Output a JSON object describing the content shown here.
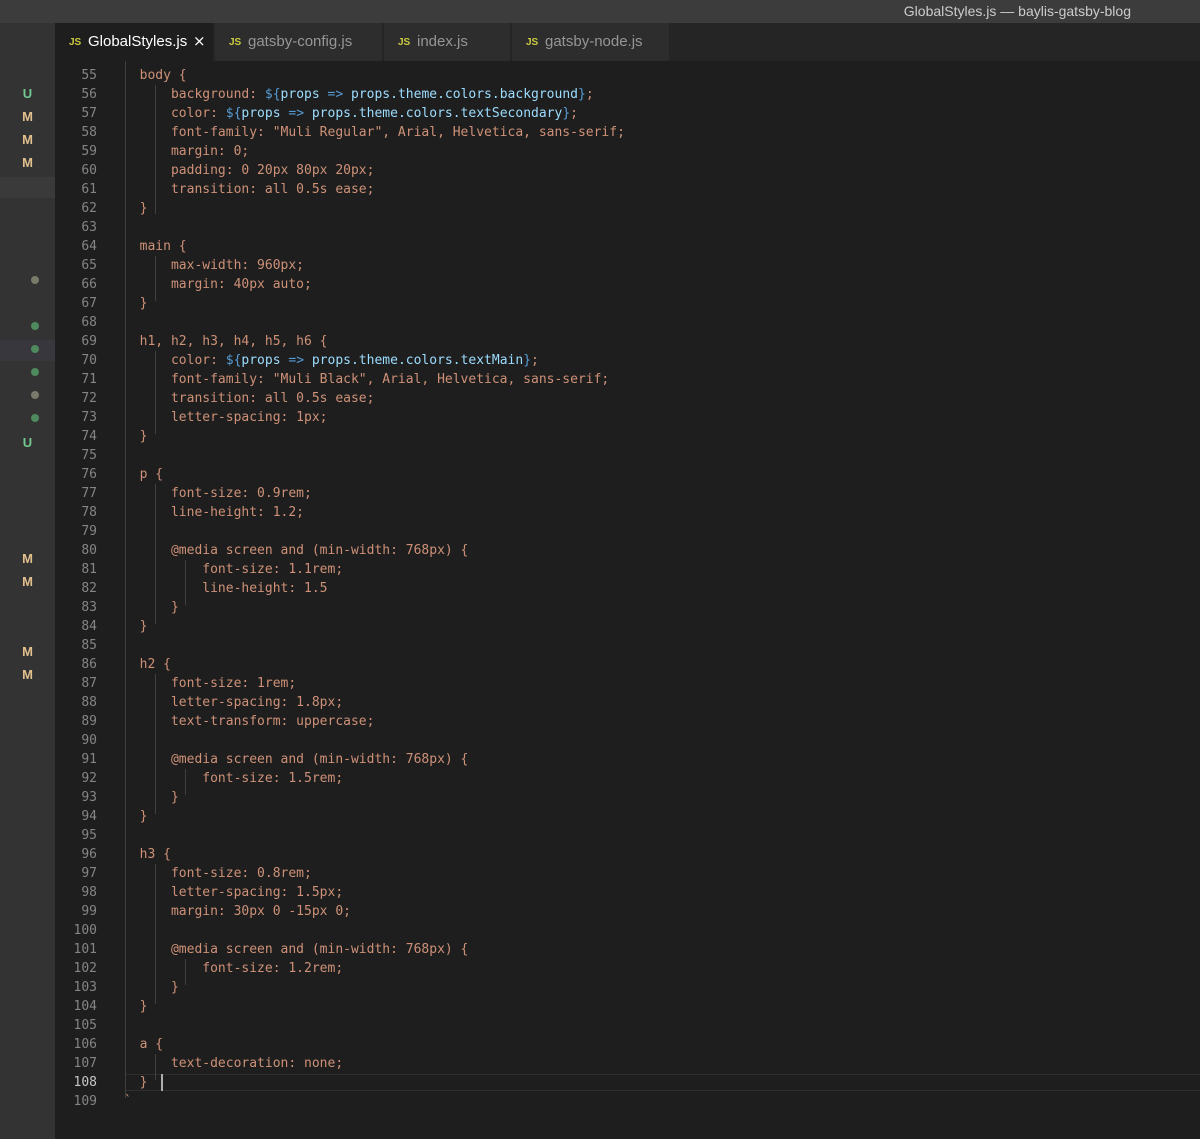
{
  "window": {
    "title": "GlobalStyles.js — baylis-gatsby-blog"
  },
  "tabs": [
    {
      "icon": "JS",
      "label": "GlobalStyles.js",
      "active": true
    },
    {
      "icon": "JS",
      "label": "gatsby-config.js",
      "active": false
    },
    {
      "icon": "JS",
      "label": "index.js",
      "active": false
    },
    {
      "icon": "JS",
      "label": "gatsby-node.js",
      "active": false
    }
  ],
  "close_glyph": "×",
  "current_line": 108,
  "colors": {
    "background": "#1e1e1e",
    "tab_icon": "#cbcb41",
    "text": "#ce9178",
    "keyword": "#569cd6",
    "variable": "#9cdcfe",
    "git_untracked": "#73c991",
    "git_modified": "#e2c08d"
  },
  "scm_markers": [
    {
      "text": "U",
      "type": "untracked"
    },
    {
      "text": "M",
      "type": "modified"
    },
    {
      "text": "M",
      "type": "modified"
    },
    {
      "text": "M",
      "type": "modified"
    },
    {
      "text": "U",
      "type": "untracked"
    },
    {
      "text": "M",
      "type": "modified"
    },
    {
      "text": "M",
      "type": "modified"
    },
    {
      "text": "M",
      "type": "modified"
    },
    {
      "text": "M",
      "type": "modified"
    }
  ],
  "code_lines": [
    {
      "n": "55",
      "text": "  body {"
    },
    {
      "n": "56",
      "text": "      background: ${props => props.theme.colors.background};"
    },
    {
      "n": "57",
      "text": "      color: ${props => props.theme.colors.textSecondary};"
    },
    {
      "n": "58",
      "text": "      font-family: \"Muli Regular\", Arial, Helvetica, sans-serif;"
    },
    {
      "n": "59",
      "text": "      margin: 0;"
    },
    {
      "n": "60",
      "text": "      padding: 0 20px 80px 20px;"
    },
    {
      "n": "61",
      "text": "      transition: all 0.5s ease;"
    },
    {
      "n": "62",
      "text": "  }"
    },
    {
      "n": "63",
      "text": ""
    },
    {
      "n": "64",
      "text": "  main {"
    },
    {
      "n": "65",
      "text": "      max-width: 960px;"
    },
    {
      "n": "66",
      "text": "      margin: 40px auto;"
    },
    {
      "n": "67",
      "text": "  }"
    },
    {
      "n": "68",
      "text": ""
    },
    {
      "n": "69",
      "text": "  h1, h2, h3, h4, h5, h6 {"
    },
    {
      "n": "70",
      "text": "      color: ${props => props.theme.colors.textMain};"
    },
    {
      "n": "71",
      "text": "      font-family: \"Muli Black\", Arial, Helvetica, sans-serif;"
    },
    {
      "n": "72",
      "text": "      transition: all 0.5s ease;"
    },
    {
      "n": "73",
      "text": "      letter-spacing: 1px;"
    },
    {
      "n": "74",
      "text": "  }"
    },
    {
      "n": "75",
      "text": ""
    },
    {
      "n": "76",
      "text": "  p {"
    },
    {
      "n": "77",
      "text": "      font-size: 0.9rem;"
    },
    {
      "n": "78",
      "text": "      line-height: 1.2;"
    },
    {
      "n": "79",
      "text": ""
    },
    {
      "n": "80",
      "text": "      @media screen and (min-width: 768px) {"
    },
    {
      "n": "81",
      "text": "          font-size: 1.1rem;"
    },
    {
      "n": "82",
      "text": "          line-height: 1.5"
    },
    {
      "n": "83",
      "text": "      }"
    },
    {
      "n": "84",
      "text": "  }"
    },
    {
      "n": "85",
      "text": ""
    },
    {
      "n": "86",
      "text": "  h2 {"
    },
    {
      "n": "87",
      "text": "      font-size: 1rem;"
    },
    {
      "n": "88",
      "text": "      letter-spacing: 1.8px;"
    },
    {
      "n": "89",
      "text": "      text-transform: uppercase;"
    },
    {
      "n": "90",
      "text": ""
    },
    {
      "n": "91",
      "text": "      @media screen and (min-width: 768px) {"
    },
    {
      "n": "92",
      "text": "          font-size: 1.5rem;"
    },
    {
      "n": "93",
      "text": "      }"
    },
    {
      "n": "94",
      "text": "  }"
    },
    {
      "n": "95",
      "text": ""
    },
    {
      "n": "96",
      "text": "  h3 {"
    },
    {
      "n": "97",
      "text": "      font-size: 0.8rem;"
    },
    {
      "n": "98",
      "text": "      letter-spacing: 1.5px;"
    },
    {
      "n": "99",
      "text": "      margin: 30px 0 -15px 0;"
    },
    {
      "n": "100",
      "text": ""
    },
    {
      "n": "101",
      "text": "      @media screen and (min-width: 768px) {"
    },
    {
      "n": "102",
      "text": "          font-size: 1.2rem;"
    },
    {
      "n": "103",
      "text": "      }"
    },
    {
      "n": "104",
      "text": "  }"
    },
    {
      "n": "105",
      "text": ""
    },
    {
      "n": "106",
      "text": "  a {"
    },
    {
      "n": "107",
      "text": "      text-decoration: none;"
    },
    {
      "n": "108",
      "text": "  }"
    },
    {
      "n": "109",
      "text": "`"
    }
  ]
}
